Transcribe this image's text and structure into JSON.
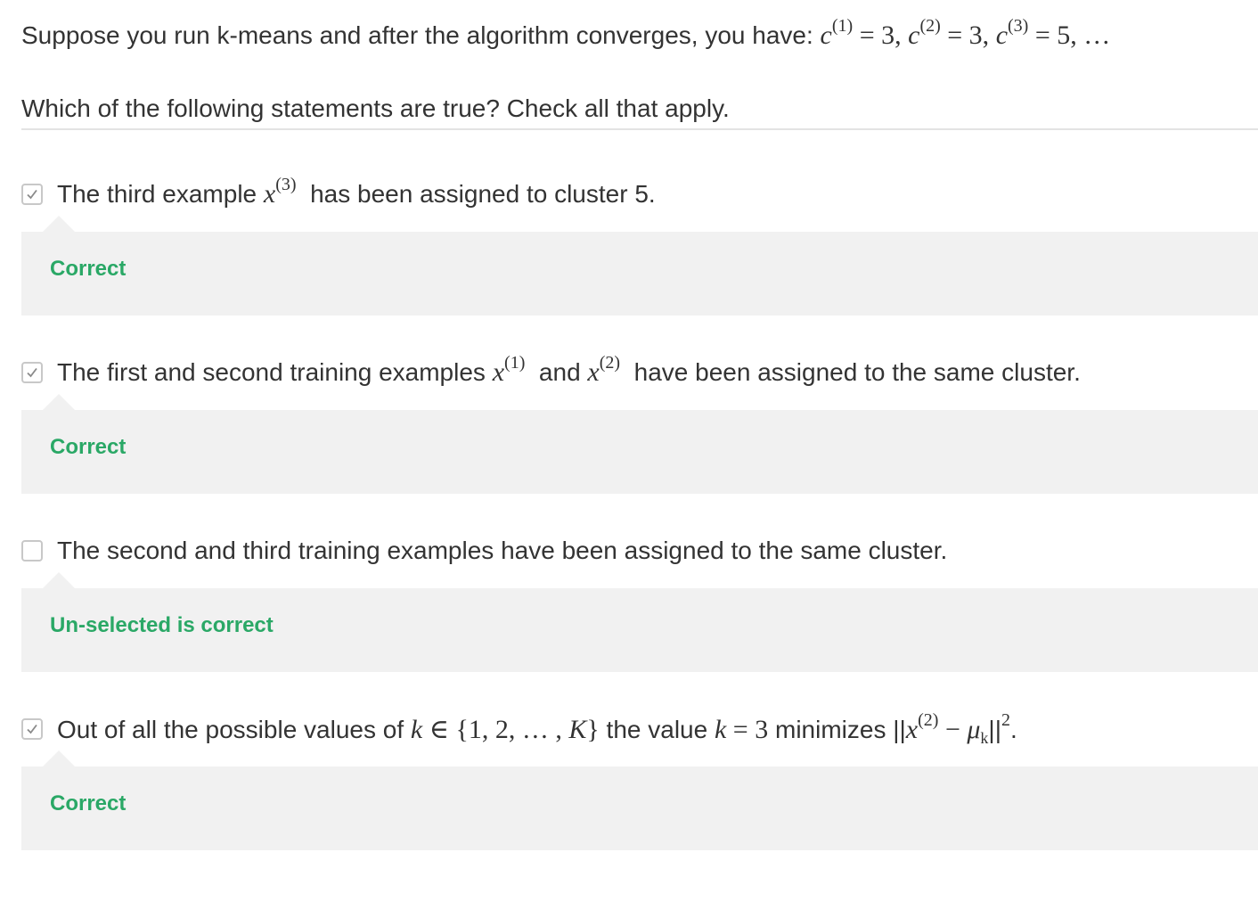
{
  "prompt": {
    "text": "Suppose you run k-means and after the algorithm converges, you have: ",
    "math": {
      "var": "c",
      "idx1": "(1)",
      "val1": " = 3, ",
      "idx2": "(2)",
      "val2": " = 3, ",
      "idx3": "(3)",
      "val3": " = 5, …"
    }
  },
  "instruction": "Which of the following statements are true? Check all that apply.",
  "options": [
    {
      "checked": true,
      "parts": {
        "a": "The third example ",
        "x": "x",
        "xsup": "(3)",
        "b": "  has been assigned to cluster 5."
      },
      "feedback": "Correct"
    },
    {
      "checked": true,
      "parts": {
        "a": "The first and second training examples ",
        "x1": "x",
        "x1sup": "(1)",
        "b": "  and ",
        "x2": "x",
        "x2sup": "(2)",
        "c": "  have been assigned to the same cluster."
      },
      "feedback": "Correct"
    },
    {
      "checked": false,
      "parts": {
        "a": "The second and third training examples have been assigned to the same cluster."
      },
      "feedback": "Un-selected is correct"
    },
    {
      "checked": true,
      "parts": {
        "a": "Out of all the possible values of ",
        "k1": "k",
        "set": " ∈ {1, 2, … , ",
        "K": "K",
        "setclose": "}",
        "b": " the value ",
        "k2": "k",
        "eq": " = 3",
        "c": " minimizes ||",
        "x": "x",
        "xsup": "(2)",
        "minus": " − ",
        "mu": "μ",
        "musub": "k",
        "d": "||",
        "pow": "2",
        "e": "."
      },
      "feedback": "Correct"
    }
  ],
  "colors": {
    "correct_green": "#2aa866",
    "feedback_bg": "#f1f1f1",
    "checkbox_border": "#c8c8c8",
    "text": "#333333"
  },
  "icons": {
    "checked": "checkmark-icon"
  }
}
